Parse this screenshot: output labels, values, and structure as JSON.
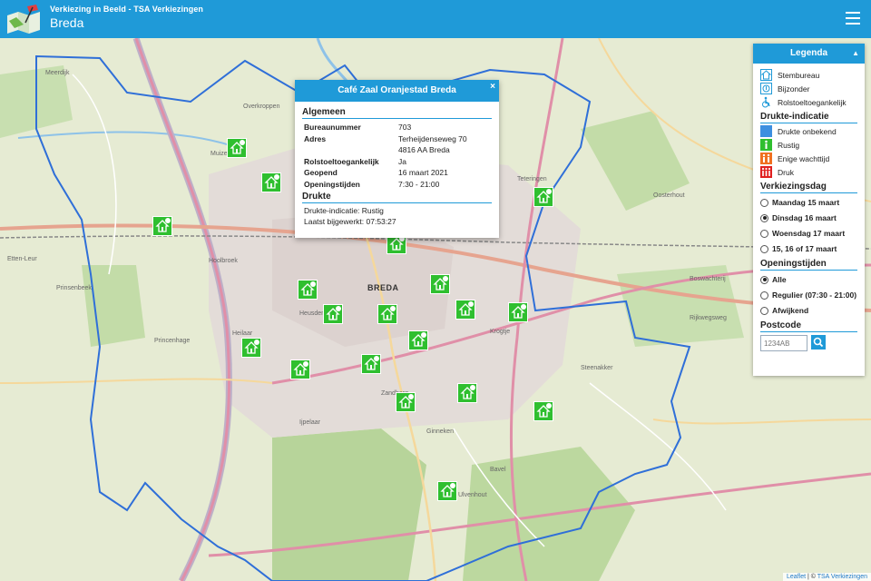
{
  "header": {
    "subtitle": "Verkiezing in Beeld - TSA Verkiezingen",
    "title": "Breda"
  },
  "colors": {
    "brand": "#1f9ad8",
    "marker_rustig": "#2fbf2f",
    "drukte_onbekend": "#3d8fe0",
    "enige_wachttijd": "#f07020",
    "druk": "#e02020",
    "boundary": "#2f6fd8"
  },
  "map": {
    "city_label": "BREDA",
    "labels": [
      "Overkroppen",
      "Muizen",
      "Meerdijk",
      "Teteringen",
      "Oosterhout",
      "Etten-Leur",
      "Prinsenbeek",
      "Hoolbroek",
      "Heilaar",
      "Zandberg",
      "Steenakker",
      "Krogtje",
      "Bavel",
      "Princenhage",
      "Ulvenhout",
      "Ginneken",
      "Ijpelaar",
      "Heusdenhout",
      "Rijkwegsweg",
      "Boswachterij"
    ],
    "marker_count": 19
  },
  "popup": {
    "title": "Café Zaal Oranjestad Breda",
    "close_label": "×",
    "section_general": "Algemeen",
    "rows": [
      {
        "key": "Bureaunummer",
        "value": "703"
      },
      {
        "key": "Adres",
        "value": "Terheijdenseweg 70"
      },
      {
        "key": "",
        "value": "4816 AA Breda"
      },
      {
        "key": "Rolstoeltoegankelijk",
        "value": "Ja"
      },
      {
        "key": "Geopend",
        "value": "16 maart 2021"
      },
      {
        "key": "Openingstijden",
        "value": "7:30 - 21:00"
      }
    ],
    "section_drukte": "Drukte",
    "drukte_text": "Drukte-indicatie: Rustig",
    "updated_text": "Laatst bijgewerkt: 07:53:27"
  },
  "legend": {
    "title": "Legenda",
    "toggle_icon": "caret-up-icon",
    "icons": [
      {
        "label": "Stembureau",
        "icon": "house-icon"
      },
      {
        "label": "Bijzonder",
        "icon": "special-icon"
      },
      {
        "label": "Rolstoeltoegankelijk",
        "icon": "wheelchair-icon"
      }
    ],
    "drukte_title": "Drukte-indicatie",
    "drukte": [
      {
        "label": "Drukte onbekend",
        "color": "#3d8fe0"
      },
      {
        "label": "Rustig",
        "color": "#2fbf2f"
      },
      {
        "label": "Enige wachttijd",
        "color": "#f07020"
      },
      {
        "label": "Druk",
        "color": "#e02020"
      }
    ],
    "dag_title": "Verkiezingsdag",
    "dagen": [
      {
        "label": "Maandag 15 maart",
        "selected": false
      },
      {
        "label": "Dinsdag 16 maart",
        "selected": true
      },
      {
        "label": "Woensdag 17 maart",
        "selected": false
      },
      {
        "label": "15, 16 of 17 maart",
        "selected": false
      }
    ],
    "tijden_title": "Openingstijden",
    "tijden": [
      {
        "label": "Alle",
        "selected": true
      },
      {
        "label": "Regulier (07:30 - 21:00)",
        "selected": false
      },
      {
        "label": "Afwijkend",
        "selected": false
      }
    ],
    "postcode_title": "Postcode",
    "postcode_placeholder": "1234AB"
  },
  "footer": {
    "leaflet": "Leaflet",
    "sep": " | © ",
    "credit": "TSA Verkiezingen"
  }
}
